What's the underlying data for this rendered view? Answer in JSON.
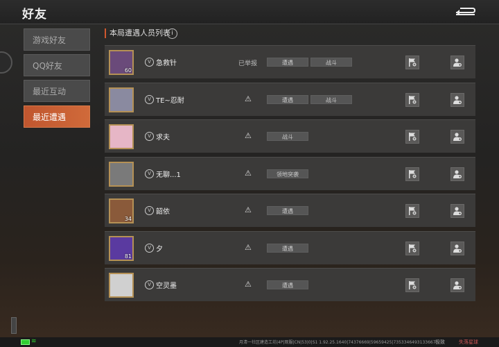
{
  "header": {
    "title": "好友"
  },
  "sidebar": {
    "items": [
      {
        "label": "游戏好友"
      },
      {
        "label": "QQ好友"
      },
      {
        "label": "最近互动"
      },
      {
        "label": "最近遭遇"
      }
    ],
    "active_index": 3
  },
  "list": {
    "title": "本局遭遇人员列表",
    "info_icon": "i",
    "rows": [
      {
        "name": "急救针",
        "level": "60",
        "status": "已举报",
        "tags": [
          "遭遇",
          "战斗"
        ]
      },
      {
        "name": "TE~忍耐",
        "level": "",
        "status": "⚠",
        "tags": [
          "遭遇",
          "战斗"
        ]
      },
      {
        "name": "求夫",
        "level": "",
        "status": "⚠",
        "tags": [
          "战斗"
        ]
      },
      {
        "name": "无聊...1",
        "level": "",
        "status": "⚠",
        "tags": [
          "领地突袭"
        ]
      },
      {
        "name": "韶依",
        "level": "34",
        "status": "⚠",
        "tags": [
          "遭遇"
        ]
      },
      {
        "name": "夕",
        "level": "81",
        "status": "⚠",
        "tags": [
          "遭遇"
        ]
      },
      {
        "name": "空灵墨",
        "level": "",
        "status": "⚠",
        "tags": [
          "遭遇"
        ]
      }
    ]
  },
  "footer": {
    "build": "月清一社区建造工坊|4P|观服|CN|53|0|S1 1.92.25.1640|74376669|59659425|7353346493133667",
    "label1": "极致",
    "label2": "失落星球"
  },
  "colors": {
    "accent": "#d0582f",
    "row_bg": "#3b3a39"
  },
  "icons": {
    "back": "back-arrow-icon",
    "flag": "flag-icon",
    "add_friend": "add-friend-icon",
    "warn": "warning-icon"
  }
}
